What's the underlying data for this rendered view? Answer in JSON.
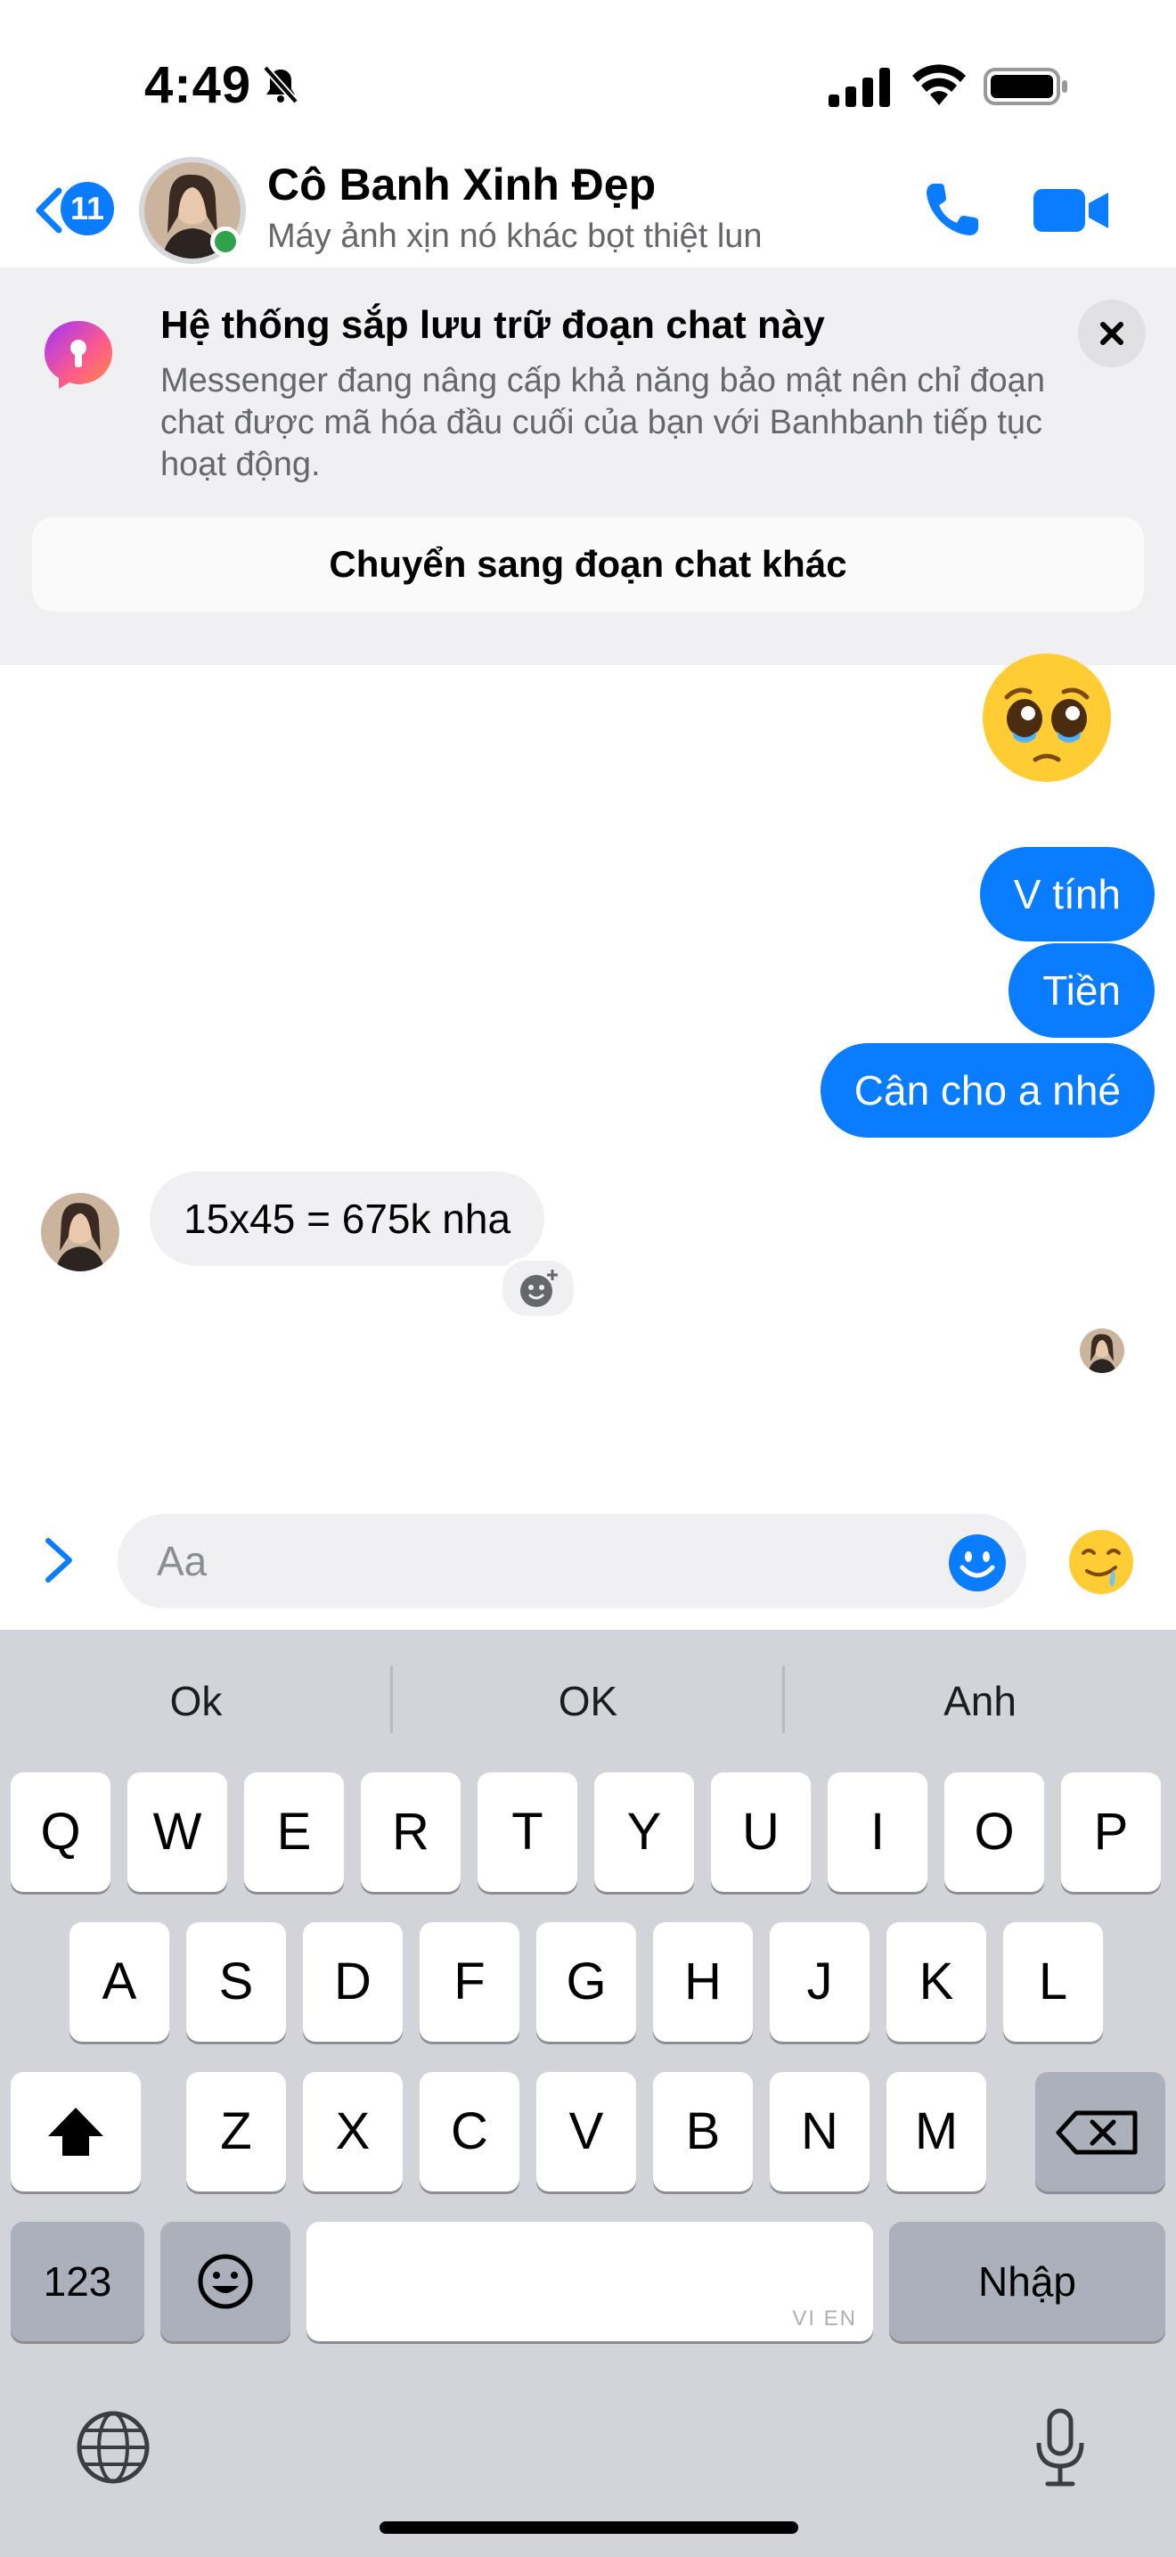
{
  "status_bar": {
    "time": "4:49"
  },
  "header": {
    "back_badge": "11",
    "contact_name": "Cô Banh Xinh Đẹp",
    "contact_status": "Máy ảnh xịn nó khác bọt thiệt lun"
  },
  "banner": {
    "title": "Hệ thống sắp lưu trữ đoạn chat này",
    "body": "Messenger đang nâng cấp khả năng bảo mật nên chỉ đoạn chat được mã hóa đầu cuối của bạn với Banhbanh tiếp tục hoạt động.",
    "action_label": "Chuyển sang đoạn chat khác"
  },
  "messages": [
    {
      "from": "me",
      "text": "V tính"
    },
    {
      "from": "me",
      "text": "Tiền"
    },
    {
      "from": "me",
      "text": "Cân cho a nhé"
    },
    {
      "from": "contact",
      "text": "15x45 = 675k nha"
    }
  ],
  "composer": {
    "placeholder": "Aa"
  },
  "keyboard": {
    "predictions": [
      "Ok",
      "OK",
      "Anh"
    ],
    "row1": [
      "Q",
      "W",
      "E",
      "R",
      "T",
      "Y",
      "U",
      "I",
      "O",
      "P"
    ],
    "row2": [
      "A",
      "S",
      "D",
      "F",
      "G",
      "H",
      "J",
      "K",
      "L"
    ],
    "row3": [
      "Z",
      "X",
      "C",
      "V",
      "B",
      "N",
      "M"
    ],
    "numbers_key": "123",
    "return_key": "Nhập",
    "space_hint": "VI EN"
  },
  "colors": {
    "accent": "#0a7cff",
    "online": "#31a24c"
  }
}
